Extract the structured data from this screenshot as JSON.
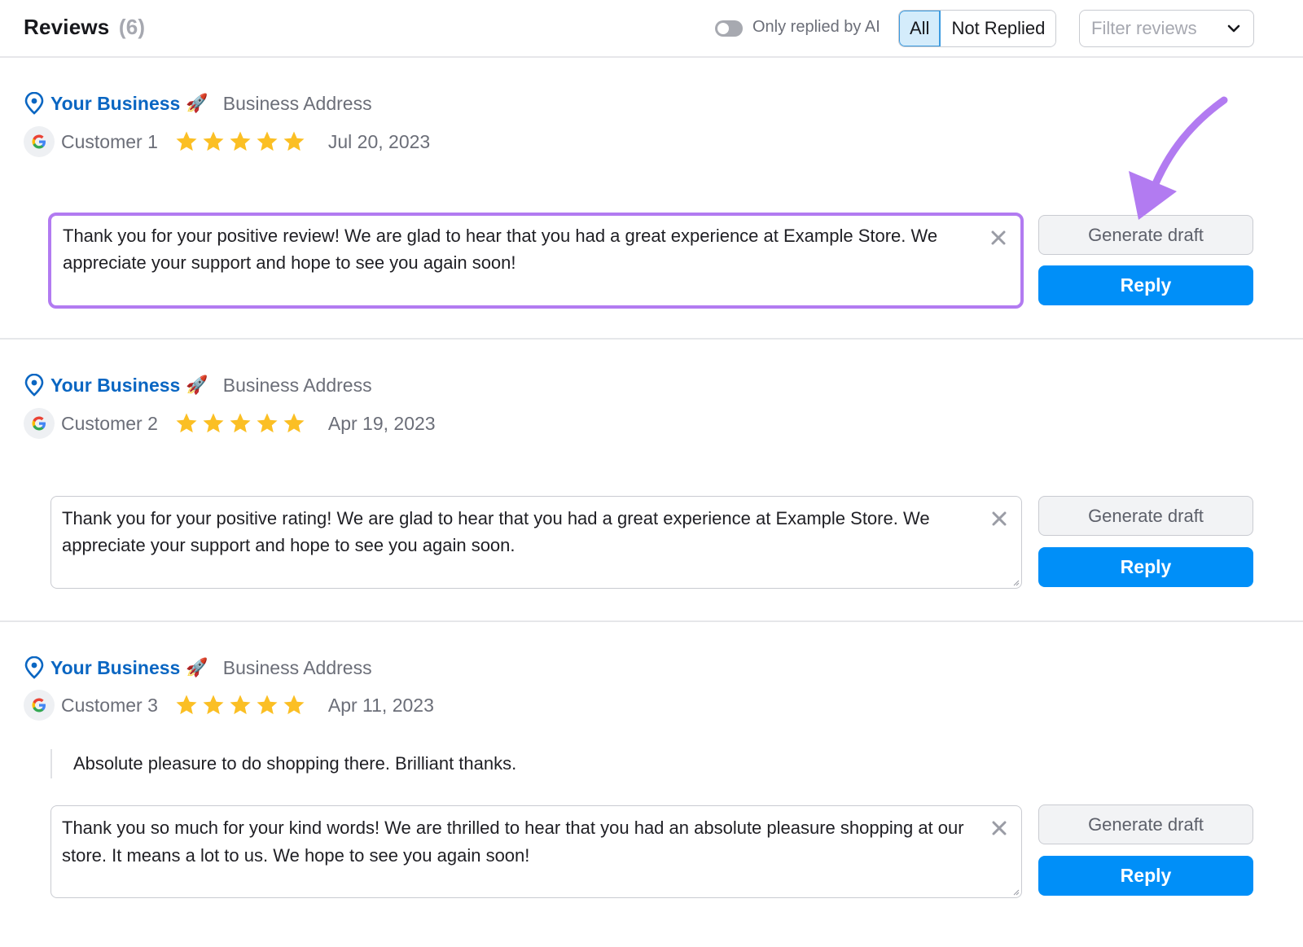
{
  "header": {
    "title": "Reviews",
    "count": "(6)",
    "toggle_label": "Only replied by AI",
    "toggle_on": false,
    "segments": [
      {
        "label": "All",
        "active": true
      },
      {
        "label": "Not Replied",
        "active": false
      }
    ],
    "filter_placeholder": "Filter reviews"
  },
  "colors": {
    "brand_link": "#0a66c2",
    "primary_button": "#008ff8",
    "star": "#fbbf24",
    "highlight": "#b27bf1"
  },
  "reviews": [
    {
      "business_name": "Your Business",
      "business_emoji": "🚀",
      "business_address": "Business Address",
      "source_icon": "google-icon",
      "customer": "Customer 1",
      "rating": 5,
      "date": "Jul 20, 2023",
      "review_text": "",
      "reply_draft": "Thank you for your positive review! We are glad to hear that you had a great experience at Example Store. We appreciate your support and hope to see you again soon!",
      "focused": true,
      "generate_label": "Generate draft",
      "reply_label": "Reply"
    },
    {
      "business_name": "Your Business",
      "business_emoji": "🚀",
      "business_address": "Business Address",
      "source_icon": "google-icon",
      "customer": "Customer 2",
      "rating": 5,
      "date": "Apr 19, 2023",
      "review_text": "",
      "reply_draft": "Thank you for your positive rating! We are glad to hear that you had a great experience at Example Store. We appreciate your support and hope to see you again soon.",
      "focused": false,
      "generate_label": "Generate draft",
      "reply_label": "Reply"
    },
    {
      "business_name": "Your Business",
      "business_emoji": "🚀",
      "business_address": "Business Address",
      "source_icon": "google-icon",
      "customer": "Customer 3",
      "rating": 5,
      "date": "Apr 11, 2023",
      "review_text": "Absolute pleasure to do shopping there. Brilliant thanks.",
      "reply_draft": "Thank you so much for your kind words! We are thrilled to hear that you had an absolute pleasure shopping at our store. It means a lot to us. We hope to see you again soon!",
      "focused": false,
      "generate_label": "Generate draft",
      "reply_label": "Reply"
    }
  ],
  "annotation": {
    "icon": "arrow-annotation-icon",
    "points_to": "Generate draft"
  }
}
